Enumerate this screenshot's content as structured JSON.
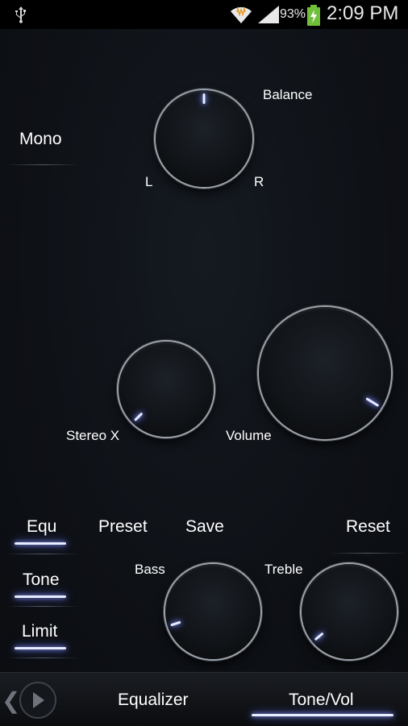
{
  "status_bar": {
    "battery_percent": "93%",
    "time": "2:09 PM",
    "icons": [
      "usb-icon",
      "wifi-icon",
      "signal-icon",
      "battery-charging-icon"
    ]
  },
  "balance": {
    "title": "Balance",
    "left_label": "L",
    "right_label": "R",
    "value_fraction": 0.5
  },
  "mono": {
    "label": "Mono"
  },
  "stereo_x": {
    "label": "Stereo X",
    "value_fraction": 0.0
  },
  "volume": {
    "label": "Volume",
    "value_fraction": 0.95
  },
  "side_buttons": {
    "equ": "Equ",
    "tone": "Tone",
    "limit": "Limit"
  },
  "actions": {
    "preset": "Preset",
    "save": "Save",
    "reset": "Reset"
  },
  "bass": {
    "label": "Bass",
    "value_fraction": 0.1
  },
  "treble": {
    "label": "Treble",
    "value_fraction": 0.02
  },
  "bottom_tabs": {
    "equalizer": "Equalizer",
    "tone_vol": "Tone/Vol",
    "active": "Tone/Vol"
  },
  "colors": {
    "accent_glow": "#8a9cff",
    "background": "#0d1015"
  }
}
